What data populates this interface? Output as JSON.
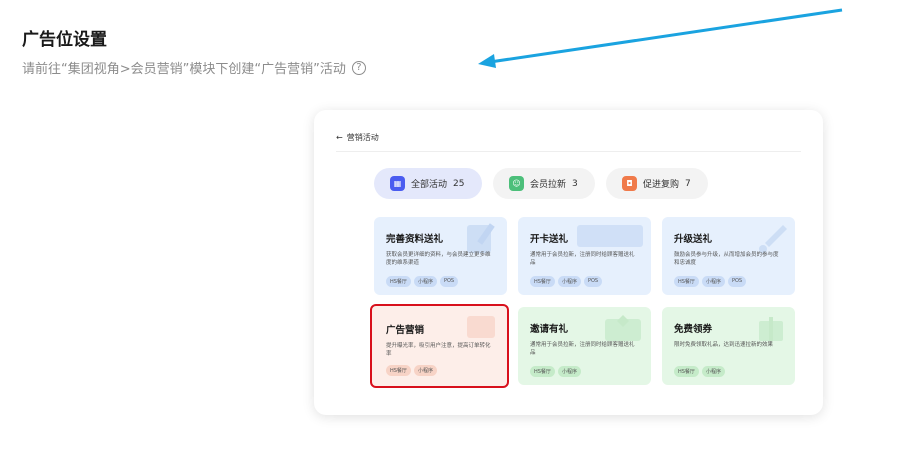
{
  "page": {
    "title": "广告位设置",
    "hint": "请前往“集团视角>会员营销”模块下创建“广告营销”活动",
    "help_icon": "?"
  },
  "colors": {
    "arrow": "#1aa3e0",
    "highlight": "#d8101c"
  },
  "panel": {
    "back_icon": "←",
    "header": "营销活动",
    "filters": [
      {
        "label": "全部活动",
        "count": "25",
        "icon": "grid-icon",
        "color": "#4a5cf0"
      },
      {
        "label": "会员拉新",
        "count": "3",
        "icon": "member-icon",
        "color": "#4cbf7a"
      },
      {
        "label": "促进复购",
        "count": "7",
        "icon": "bag-icon",
        "color": "#f07a4a"
      }
    ],
    "cards": [
      {
        "title": "完善资料送礼",
        "desc": "获取会员更详细的资料，与会员建立更多维度的维系渠道",
        "tags": [
          "HS餐厅",
          "小程序",
          "POS"
        ]
      },
      {
        "title": "开卡送礼",
        "desc": "通常用于会员拉新，注册同时给顾客赠送礼品",
        "tags": [
          "HS餐厅",
          "小程序",
          "POS"
        ]
      },
      {
        "title": "升级送礼",
        "desc": "鼓励会员参与升级，从而增加会员的参与度和忠诚度",
        "tags": [
          "HS餐厅",
          "小程序",
          "POS"
        ]
      },
      {
        "title": "广告营销",
        "desc": "提升曝光率，吸引用户注意，提高订单转化率",
        "tags": [
          "HS餐厅",
          "小程序"
        ]
      },
      {
        "title": "邀请有礼",
        "desc": "通常用于会员拉新，注册同时给顾客赠送礼品",
        "tags": [
          "HS餐厅",
          "小程序"
        ]
      },
      {
        "title": "免费领券",
        "desc": "限时免费领取礼品，达到迅速拉新的效果",
        "tags": [
          "HS餐厅",
          "小程序"
        ]
      }
    ]
  }
}
